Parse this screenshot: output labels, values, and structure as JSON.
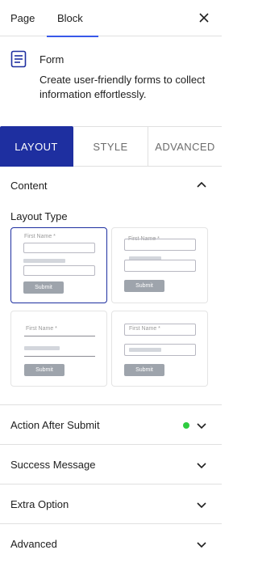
{
  "top_tabs": {
    "page": "Page",
    "block": "Block"
  },
  "block": {
    "title": "Form",
    "description": "Create user-friendly forms to collect information effortlessly."
  },
  "settings_tabs": {
    "layout": "LAYOUT",
    "style": "STYLE",
    "advanced": "ADVANCED"
  },
  "content_panel": {
    "title": "Content",
    "layout_type_label": "Layout Type"
  },
  "layout_cards": {
    "first_name": "First Name *",
    "submit": "Submit"
  },
  "accordion": {
    "action_after_submit": "Action After Submit",
    "success_message": "Success Message",
    "extra_option": "Extra Option",
    "advanced": "Advanced"
  },
  "colors": {
    "accent": "#1e2fa0",
    "tab_underline": "#3858e9",
    "status_green": "#2ecc40"
  },
  "icons": [
    "close-icon",
    "form-block-icon",
    "chevron-up-icon",
    "chevron-down-icon"
  ]
}
